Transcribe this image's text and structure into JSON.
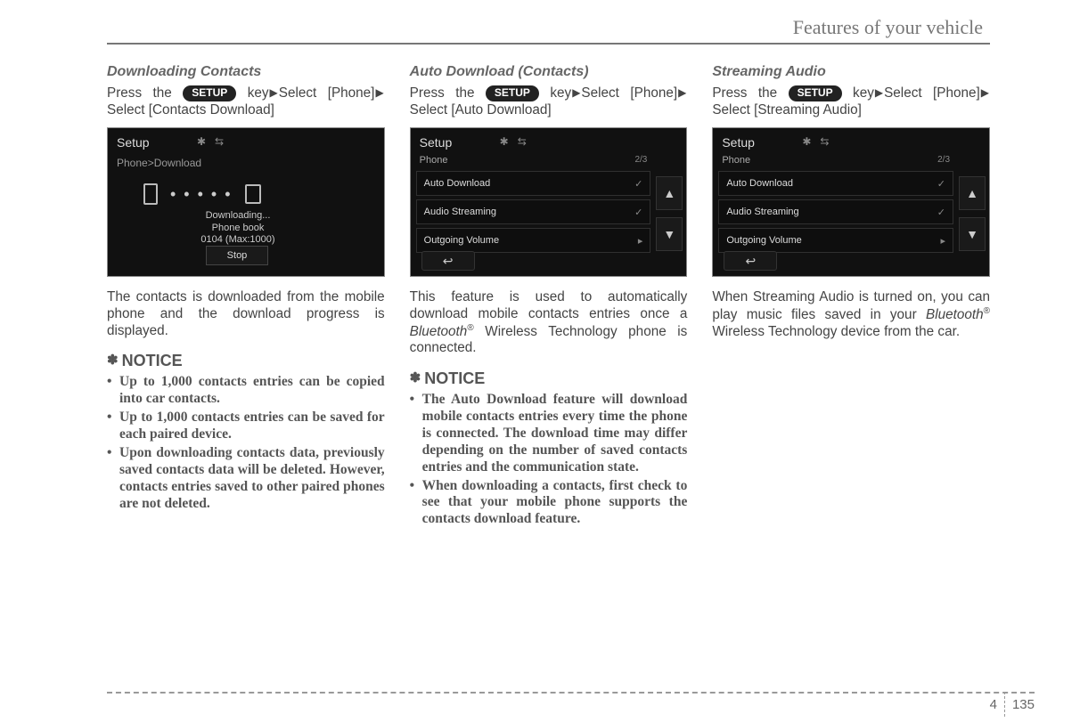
{
  "chapter": "Features of your vehicle",
  "button_label": "SETUP",
  "page_section": "4",
  "page_number": "135",
  "col1": {
    "title": "Downloading Contacts",
    "instr_pre": "Press the ",
    "instr_post": " key",
    "instr_sel1": "Select [Phone]",
    "instr_sel2": "Select [Contacts Download]",
    "screenshot": {
      "title": "Setup",
      "breadcrumb": "Phone>Download",
      "dl_line1": "Downloading...",
      "dl_line2": "Phone book",
      "dl_line3": "0104 (Max:1000)",
      "stop": "Stop"
    },
    "body": "The contacts is downloaded from the mobile phone and the download progress is displayed.",
    "notice_label": "NOTICE",
    "notice": [
      "Up to 1,000 contacts entries can be copied into car contacts.",
      "Up to 1,000 contacts entries can be saved for each paired device.",
      "Upon downloading contacts data, previously saved contacts data will be deleted. However, contacts entries saved to other paired phones are not deleted."
    ]
  },
  "col2": {
    "title": "Auto Download (Contacts)",
    "instr_pre": "Press the ",
    "instr_post": " key",
    "instr_sel1": "Select [Phone]",
    "instr_sel2": "Select [Auto Download]",
    "screenshot": {
      "title": "Setup",
      "crumb": "Phone",
      "page": "2/3",
      "items": [
        {
          "label": "Auto Download",
          "ind": "✓"
        },
        {
          "label": "Audio Streaming",
          "ind": "✓"
        },
        {
          "label": "Outgoing Volume",
          "ind": "▸"
        }
      ]
    },
    "body_pre": "This feature is used to automatically download mobile contacts entries once a ",
    "body_bt": "Bluetooth",
    "body_post": " Wireless Technology phone is connected.",
    "notice_label": "NOTICE",
    "notice": [
      "The Auto Download feature will download mobile contacts entries every time the phone is connected. The download time may differ depending on the number of saved contacts entries and the communication state.",
      "When downloading a contacts, first check to see that your mobile phone supports the contacts download feature."
    ]
  },
  "col3": {
    "title": "Streaming Audio",
    "instr_pre": "Press the ",
    "instr_post": " key",
    "instr_sel1": "Select [Phone]",
    "instr_sel2": "Select [Streaming Audio]",
    "screenshot": {
      "title": "Setup",
      "crumb": "Phone",
      "page": "2/3",
      "items": [
        {
          "label": "Auto Download",
          "ind": "✓"
        },
        {
          "label": "Audio Streaming",
          "ind": "✓"
        },
        {
          "label": "Outgoing Volume",
          "ind": "▸"
        }
      ]
    },
    "body_pre": "When Streaming Audio is turned on, you can play music files saved in your ",
    "body_bt": "Bluetooth",
    "body_post": " Wireless Technology device from the car."
  }
}
